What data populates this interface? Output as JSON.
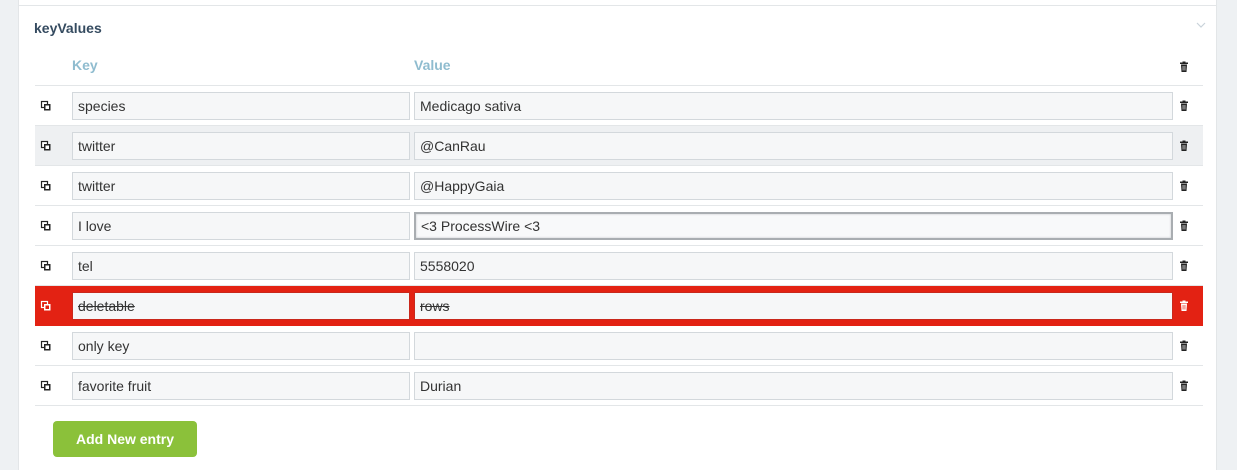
{
  "field": {
    "title": "keyValues"
  },
  "columns": {
    "key": "Key",
    "value": "Value"
  },
  "rows": [
    {
      "key": "species",
      "value": "Medicago sativa",
      "state": "normal"
    },
    {
      "key": "twitter",
      "value": "@CanRau",
      "state": "alt"
    },
    {
      "key": "twitter",
      "value": "@HappyGaia",
      "state": "normal"
    },
    {
      "key": "I love",
      "value": "<3 ProcessWire <3",
      "state": "focused"
    },
    {
      "key": "tel",
      "value": "5558020",
      "state": "normal"
    },
    {
      "key": "deletable",
      "value": "rows",
      "state": "deleted"
    },
    {
      "key": "only key",
      "value": "",
      "state": "normal"
    },
    {
      "key": "favorite fruit",
      "value": "Durian",
      "state": "normal"
    }
  ],
  "actions": {
    "add_label": "Add New entry"
  },
  "icons": {
    "drag": "copy-icon",
    "delete": "trash-icon",
    "collapse": "chevron-down-icon"
  },
  "colors": {
    "header_text": "#8fbccf",
    "title_text": "#354b60",
    "deleted_row": "#e32213",
    "add_button": "#8bc13a"
  }
}
